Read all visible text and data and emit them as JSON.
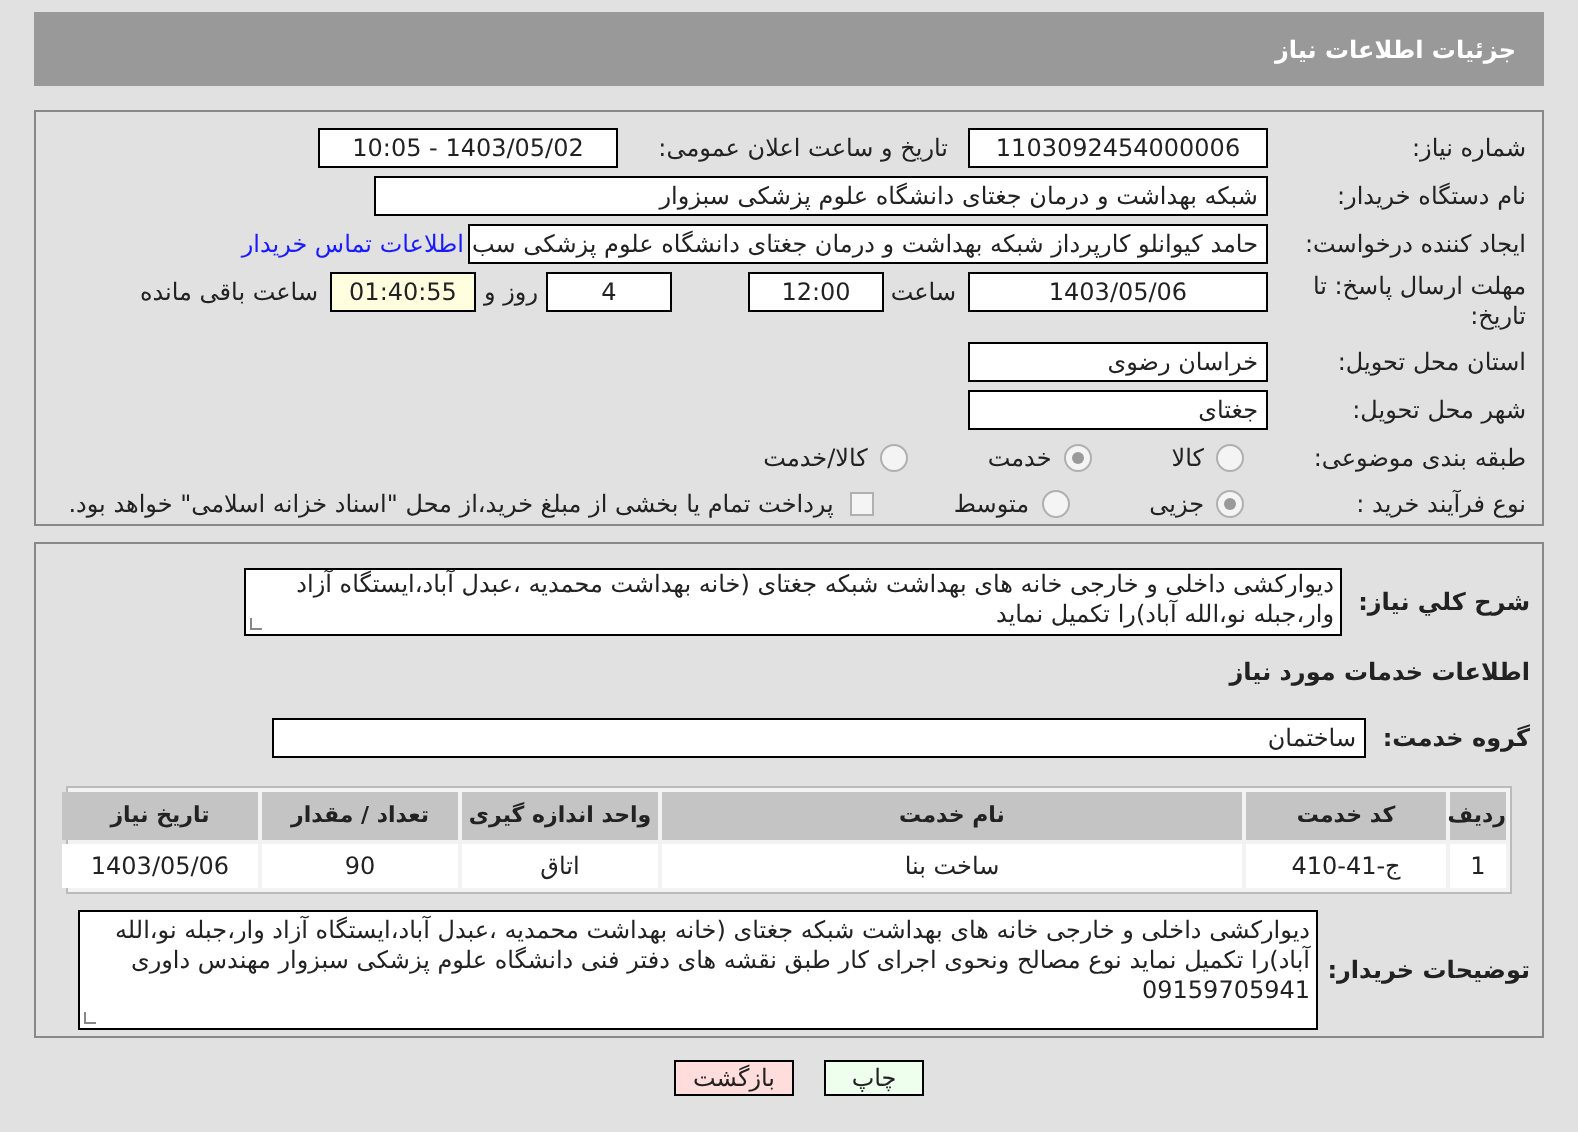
{
  "header": {
    "title": "جزئیات اطلاعات نیاز"
  },
  "details": {
    "need_number": {
      "label": "شماره نیاز:",
      "value": "1103092454000006"
    },
    "announce_date": {
      "label": "تاریخ و ساعت اعلان عمومی:",
      "value": "1403/05/02 - 10:05"
    },
    "buyer_org": {
      "label": "نام دستگاه خریدار:",
      "value": "شبکه بهداشت و درمان جغتای   دانشگاه علوم پزشکی سبزوار"
    },
    "requester": {
      "label": "ایجاد کننده درخواست:",
      "value": "حامد کیوانلو کارپرداز شبکه بهداشت و درمان جغتای   دانشگاه علوم پزشکی سب",
      "link": "اطلاعات تماس خریدار"
    },
    "deadline": {
      "label": "مهلت ارسال پاسخ: تا تاریخ:",
      "date": "1403/05/06",
      "time_label": "ساعت",
      "time": "12:00",
      "days": "4",
      "days_label": "روز و",
      "remaining": "01:40:55",
      "remaining_label": "ساعت باقی مانده"
    },
    "province": {
      "label": "استان محل تحویل:",
      "value": "خراسان رضوی"
    },
    "city": {
      "label": "شهر محل تحویل:",
      "value": "جغتای"
    },
    "category": {
      "label": "طبقه بندی موضوعی:",
      "options": [
        {
          "label": "کالا",
          "selected": false
        },
        {
          "label": "خدمت",
          "selected": true
        },
        {
          "label": "کالا/خدمت",
          "selected": false
        }
      ]
    },
    "process": {
      "label": "نوع فرآیند خرید :",
      "options": [
        {
          "label": "جزیی",
          "selected": true
        },
        {
          "label": "متوسط",
          "selected": false
        }
      ],
      "treasury": {
        "label": "پرداخت تمام یا بخشی از مبلغ خرید،از محل \"اسناد خزانه اسلامی\" خواهد بود.",
        "checked": false
      }
    }
  },
  "services": {
    "summary": {
      "label": "شرح کلي نياز:",
      "value": "دیوارکشی داخلی و خارجی خانه های بهداشت شبکه جغتای (خانه بهداشت محمدیه ،عبدل آباد،ایستگاه آزاد وار،جبله نو،الله آباد)را تکمیل نماید"
    },
    "heading": "اطلاعات خدمات مورد نياز",
    "group": {
      "label": "گروه خدمت:",
      "value": "ساختمان"
    },
    "table": {
      "columns": [
        "ردیف",
        "کد خدمت",
        "نام خدمت",
        "واحد اندازه گیری",
        "تعداد / مقدار",
        "تاریخ نیاز"
      ],
      "rows": [
        [
          "1",
          "ج-41-410",
          "ساخت بنا",
          "اتاق",
          "90",
          "1403/05/06"
        ]
      ]
    },
    "notes": {
      "label": "توضیحات خریدار:",
      "value": "دیوارکشی داخلی و خارجی خانه های بهداشت شبکه جغتای (خانه بهداشت محمدیه ،عبدل آباد،ایستگاه آزاد وار،جبله نو،الله آباد)را تکمیل نماید نوع مصالح ونحوی اجرای کار طبق نقشه های دفتر فنی دانشگاه علوم پزشکی سبزوار مهندس داوری 09159705941"
    }
  },
  "buttons": [
    {
      "label": "چاپ",
      "kind": "print"
    },
    {
      "label": "بازگشت",
      "kind": "back"
    }
  ]
}
